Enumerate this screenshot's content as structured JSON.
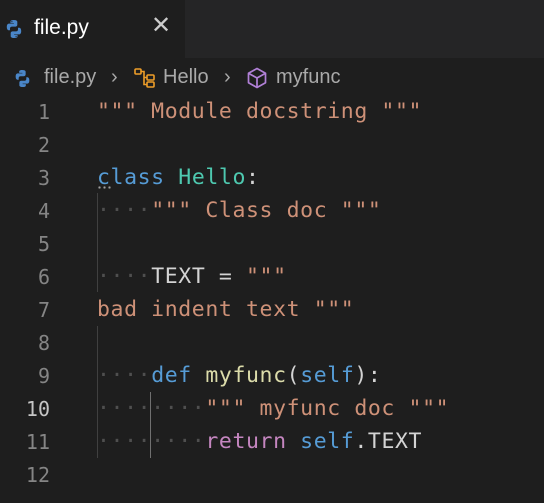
{
  "tab": {
    "label": "file.py",
    "close_glyph": "✕",
    "icon": "python-icon"
  },
  "breadcrumb": {
    "file": "file.py",
    "class": "Hello",
    "method": "myfunc",
    "separator": "›"
  },
  "editor": {
    "active_line": 10,
    "lines": [
      {
        "n": "1"
      },
      {
        "n": "2"
      },
      {
        "n": "3"
      },
      {
        "n": "4"
      },
      {
        "n": "5"
      },
      {
        "n": "6"
      },
      {
        "n": "7"
      },
      {
        "n": "8"
      },
      {
        "n": "9"
      },
      {
        "n": "10"
      },
      {
        "n": "11"
      },
      {
        "n": "12"
      }
    ],
    "tokens": {
      "l1": "\"\"\" Module docstring \"\"\"",
      "l3_kw": "class",
      "l3_name": "Hello",
      "l3_colon": ":",
      "l4_ws": "····",
      "l4_str": "\"\"\" Class doc \"\"\"",
      "l6_ws": "····",
      "l6_name": "TEXT = ",
      "l6_str": "\"\"\"",
      "l7_str": "bad indent text \"\"\"",
      "l9_ws": "····",
      "l9_kw": "def",
      "l9_fn": "myfunc",
      "l9_open": "(",
      "l9_self": "self",
      "l9_close": "):",
      "l10_ws": "········",
      "l10_str": "\"\"\" myfunc doc \"\"\"",
      "l11_ws": "········",
      "l11_kw": "return",
      "l11_self": "self",
      "l11_attr": ".TEXT"
    }
  },
  "colors": {
    "background": "#1e1e1e",
    "string": "#ce9178",
    "keyword": "#569cd6",
    "class_name": "#4ec9b0",
    "function": "#dcdcaa",
    "control": "#c586c0"
  }
}
